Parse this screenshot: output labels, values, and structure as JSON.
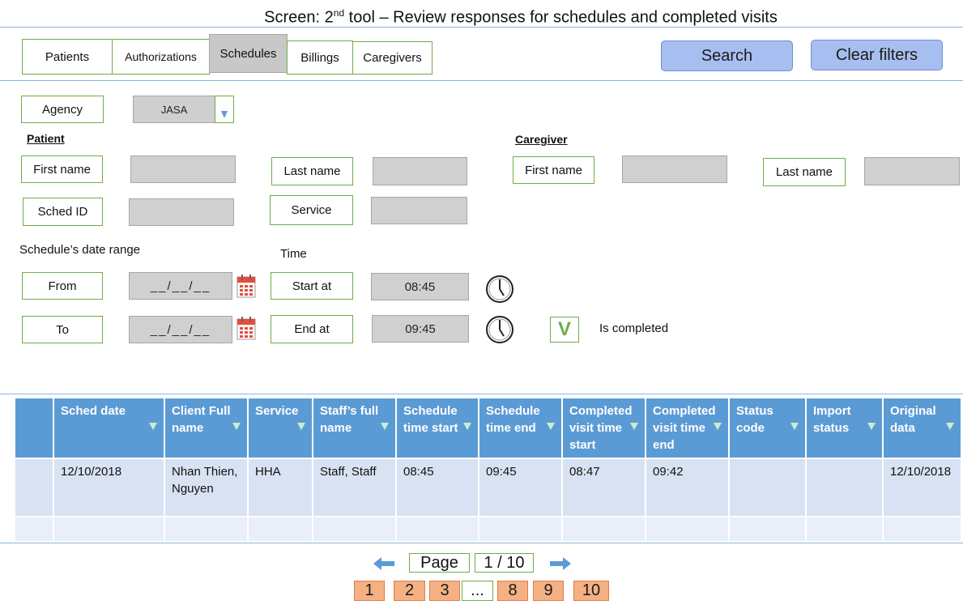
{
  "screen": {
    "title_pre": "Screen: 2",
    "title_sup": "nd",
    "title_post": " tool – Review responses for schedules and completed visits"
  },
  "tabs": [
    {
      "label": "Patients",
      "active": false
    },
    {
      "label": "Authorizations",
      "active": false
    },
    {
      "label": "Schedules",
      "active": true
    },
    {
      "label": "Billings",
      "active": false
    },
    {
      "label": "Caregivers",
      "active": false
    }
  ],
  "actions": {
    "search": "Search",
    "clear": "Clear filters"
  },
  "agency": {
    "label": "Agency",
    "value": "JASA",
    "icon": "chevron-down-icon"
  },
  "patient": {
    "section": "Patient",
    "first_name_label": "First name",
    "last_name_label": "Last name",
    "sched_id_label": "Sched ID",
    "service_label": "Service"
  },
  "caregiver": {
    "section": "Caregiver",
    "first_name_label": "First name",
    "last_name_label": "Last name"
  },
  "date_range": {
    "heading": "Schedule’s date range",
    "from_label": "From",
    "to_label": "To",
    "from_value": "__/__/__",
    "to_value": "__/__/__"
  },
  "time": {
    "heading": "Time",
    "start_label": "Start at",
    "end_label": "End at",
    "start_value": "08:45",
    "end_value": "09:45"
  },
  "completed": {
    "check": "V",
    "label": "Is completed"
  },
  "table": {
    "columns": [
      "",
      "Sched date",
      "Client Full name",
      "Service",
      "Staff’s full name",
      "Schedule time start",
      "Schedule time end",
      "Completed visit time start",
      "Completed visit time end",
      "Status code",
      "Import status",
      "Original data"
    ],
    "rows": [
      [
        "",
        "12/10/2018",
        "Nhan Thien, Nguyen",
        "HHA",
        "Staff, Staff",
        "08:45",
        "09:45",
        "08:47",
        "09:42",
        "",
        "",
        "12/10/2018"
      ],
      [
        "",
        "",
        "",
        "",
        "",
        "",
        "",
        "",
        "",
        "",
        "",
        ""
      ]
    ]
  },
  "pager": {
    "label": "Page",
    "current": "1 / 10",
    "pages": [
      "1",
      "2",
      "3",
      "...",
      "8",
      "9",
      "10"
    ],
    "colors": {
      "page": "#f4b183",
      "accent": "#5b9bd5",
      "border": "#70ad47"
    }
  }
}
